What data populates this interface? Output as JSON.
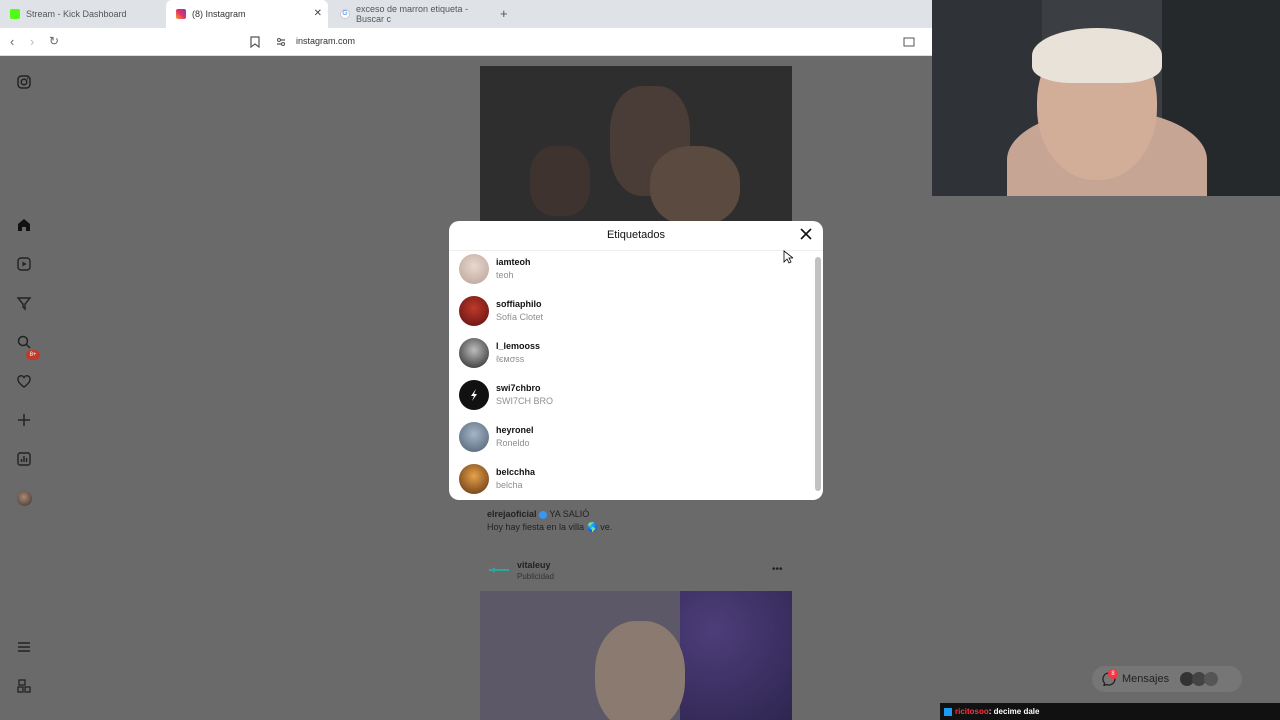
{
  "browser": {
    "tabs": [
      {
        "label": "Stream - Kick Dashboard"
      },
      {
        "label": "(8) Instagram"
      },
      {
        "label": "exceso de marron etiqueta - Buscar c"
      }
    ],
    "url": "instagram.com"
  },
  "sidebar": {
    "notification_count": "8+"
  },
  "modal": {
    "title": "Etiquetados",
    "users": [
      {
        "username": "iamteoh",
        "fullname": "teoh"
      },
      {
        "username": "soffiaphilo",
        "fullname": "Sofía Clotet"
      },
      {
        "username": "l_lemooss",
        "fullname": "ℓємσѕѕ"
      },
      {
        "username": "swi7chbro",
        "fullname": "SWI7CH BRO"
      },
      {
        "username": "heyronel",
        "fullname": "Roneldo"
      },
      {
        "username": "belcchha",
        "fullname": "belcha"
      }
    ]
  },
  "feed": {
    "caption_user": "elrejaoficial",
    "caption_text": "YA SALIÓ",
    "caption_line2": "Hoy hay fiesta en la villa 🌎 ve.",
    "post_user": "vitaleuy",
    "post_sub": "Publicidad",
    "more": "•••"
  },
  "messages": {
    "label": "Mensajes",
    "count": "8"
  },
  "chat": {
    "username": "ricitosoo",
    "message": ": decime dale"
  },
  "colors": {
    "instagram_badge": "#ff3040",
    "kick_green": "#53fc18",
    "backdrop": "#6a6a6a"
  }
}
